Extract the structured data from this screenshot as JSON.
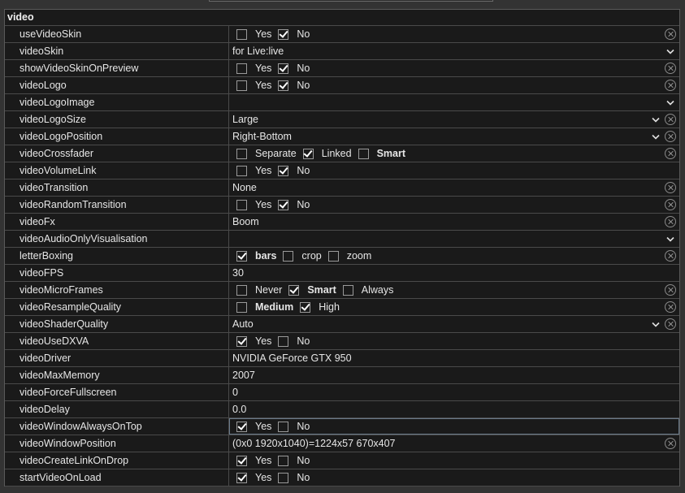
{
  "section": {
    "title": "video"
  },
  "rows": [
    {
      "name": "useVideoSkin",
      "type": "check",
      "options": [
        {
          "label": "Yes",
          "checked": false
        },
        {
          "label": "No",
          "checked": true
        }
      ],
      "clear": true
    },
    {
      "name": "videoSkin",
      "type": "dropdown",
      "value": "for Live:live",
      "clear": false
    },
    {
      "name": "showVideoSkinOnPreview",
      "type": "check",
      "options": [
        {
          "label": "Yes",
          "checked": false
        },
        {
          "label": "No",
          "checked": true
        }
      ],
      "clear": true
    },
    {
      "name": "videoLogo",
      "type": "check",
      "options": [
        {
          "label": "Yes",
          "checked": false
        },
        {
          "label": "No",
          "checked": true
        }
      ],
      "clear": true
    },
    {
      "name": "videoLogoImage",
      "type": "dropdown",
      "value": "",
      "clear": false
    },
    {
      "name": "videoLogoSize",
      "type": "dropdown",
      "value": "Large",
      "clear": true
    },
    {
      "name": "videoLogoPosition",
      "type": "dropdown",
      "value": "Right-Bottom",
      "clear": true
    },
    {
      "name": "videoCrossfader",
      "type": "check",
      "options": [
        {
          "label": "Separate",
          "checked": false
        },
        {
          "label": "Linked",
          "checked": true
        },
        {
          "label": "Smart",
          "checked": false,
          "bold": true
        }
      ],
      "clear": true
    },
    {
      "name": "videoVolumeLink",
      "type": "check",
      "options": [
        {
          "label": "Yes",
          "checked": false
        },
        {
          "label": "No",
          "checked": true
        }
      ],
      "clear": false
    },
    {
      "name": "videoTransition",
      "type": "text",
      "value": "None",
      "clear": true
    },
    {
      "name": "videoRandomTransition",
      "type": "check",
      "options": [
        {
          "label": "Yes",
          "checked": false
        },
        {
          "label": "No",
          "checked": true
        }
      ],
      "clear": true
    },
    {
      "name": "videoFx",
      "type": "text",
      "value": "Boom",
      "clear": true
    },
    {
      "name": "videoAudioOnlyVisualisation",
      "type": "dropdown",
      "value": "",
      "clear": false
    },
    {
      "name": "letterBoxing",
      "type": "check",
      "options": [
        {
          "label": "bars",
          "checked": true,
          "bold": true
        },
        {
          "label": "crop",
          "checked": false
        },
        {
          "label": "zoom",
          "checked": false
        }
      ],
      "clear": true
    },
    {
      "name": "videoFPS",
      "type": "text",
      "value": "30",
      "clear": false
    },
    {
      "name": "videoMicroFrames",
      "type": "check",
      "options": [
        {
          "label": "Never",
          "checked": false
        },
        {
          "label": "Smart",
          "checked": true,
          "bold": true
        },
        {
          "label": "Always",
          "checked": false
        }
      ],
      "clear": true
    },
    {
      "name": "videoResampleQuality",
      "type": "check",
      "options": [
        {
          "label": "Medium",
          "checked": false,
          "bold": true
        },
        {
          "label": "High",
          "checked": true
        }
      ],
      "clear": true
    },
    {
      "name": "videoShaderQuality",
      "type": "dropdown",
      "value": "Auto",
      "clear": true
    },
    {
      "name": "videoUseDXVA",
      "type": "check",
      "options": [
        {
          "label": "Yes",
          "checked": true
        },
        {
          "label": "No",
          "checked": false
        }
      ],
      "clear": false
    },
    {
      "name": "videoDriver",
      "type": "text",
      "value": "NVIDIA GeForce GTX 950",
      "clear": false
    },
    {
      "name": "videoMaxMemory",
      "type": "text",
      "value": "2007",
      "clear": false
    },
    {
      "name": "videoForceFullscreen",
      "type": "text",
      "value": "0",
      "clear": false
    },
    {
      "name": "videoDelay",
      "type": "text",
      "value": "0.0",
      "clear": false
    },
    {
      "name": "videoWindowAlwaysOnTop",
      "type": "check",
      "options": [
        {
          "label": "Yes",
          "checked": true
        },
        {
          "label": "No",
          "checked": false
        }
      ],
      "clear": false,
      "focused": true
    },
    {
      "name": "videoWindowPosition",
      "type": "text",
      "value": "(0x0 1920x1040)=1224x57 670x407",
      "clear": true
    },
    {
      "name": "videoCreateLinkOnDrop",
      "type": "check",
      "options": [
        {
          "label": "Yes",
          "checked": true
        },
        {
          "label": "No",
          "checked": false
        }
      ],
      "clear": false
    },
    {
      "name": "startVideoOnLoad",
      "type": "check",
      "options": [
        {
          "label": "Yes",
          "checked": true
        },
        {
          "label": "No",
          "checked": false
        }
      ],
      "clear": false
    }
  ]
}
